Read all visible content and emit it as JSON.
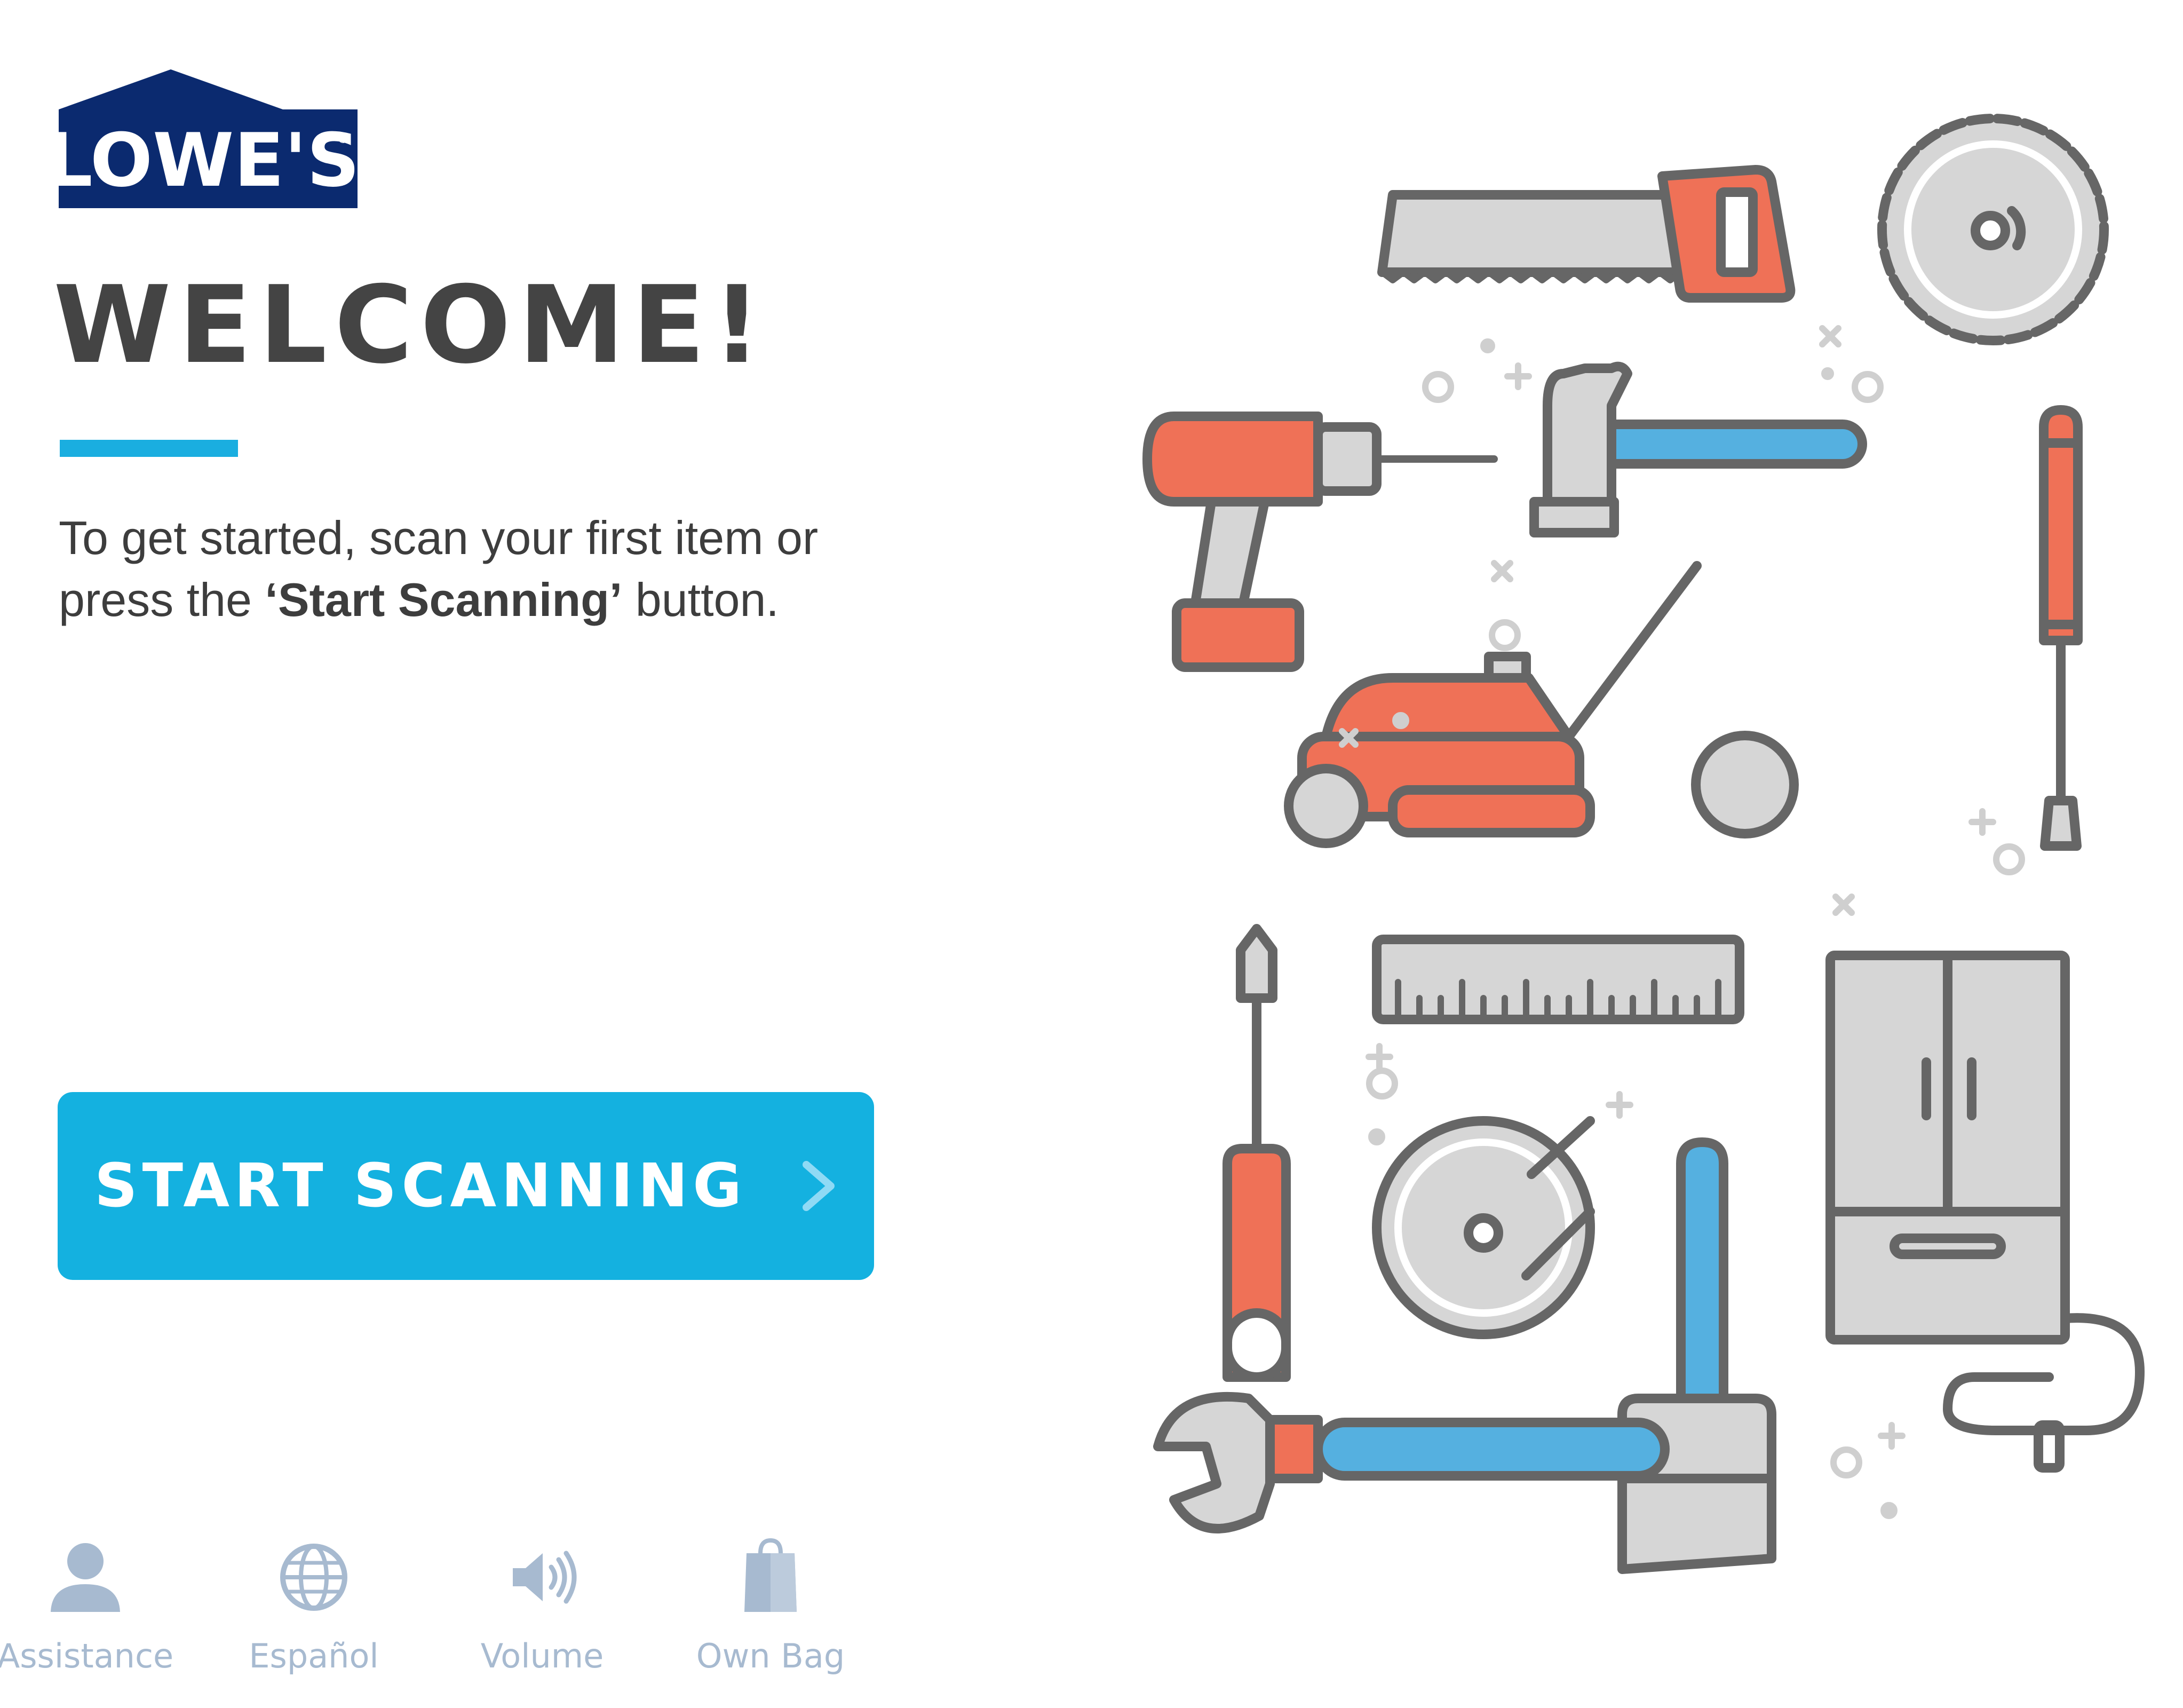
{
  "brand": {
    "logo_text": "LOWE'S",
    "registered_mark": "®"
  },
  "welcome": {
    "title": "WELCOME!",
    "intro_part1": "To get started, scan your first item or press the ",
    "intro_bold": "‘Start Scanning’",
    "intro_part2": " button."
  },
  "start_button": {
    "label": "START SCANNING",
    "icon": "chevron-right-icon"
  },
  "bottom_bar": {
    "items": [
      {
        "label": "Assistance",
        "icon": "person-icon"
      },
      {
        "label": "Español",
        "icon": "globe-icon"
      },
      {
        "label": "Volume",
        "icon": "speaker-icon"
      },
      {
        "label": "Own Bag",
        "icon": "bag-icon"
      }
    ]
  },
  "colors": {
    "brand_navy": "#0b2a6f",
    "accent_blue": "#14b1e0",
    "heading_gray": "#444444",
    "icon_muted_blue": "#a7bad0",
    "tool_orange": "#ef7157",
    "tool_gray": "#666666",
    "tool_light": "#d6d6d6",
    "tool_blue": "#55b0e0"
  },
  "illustration_icons": [
    "hand-saw-icon",
    "saw-blade-icon",
    "drill-icon",
    "hammer-icon",
    "screwdriver-icon",
    "lawn-mower-icon",
    "ruler-icon",
    "refrigerator-icon",
    "disc-icon",
    "paintbrush-icon",
    "wrench-icon"
  ]
}
